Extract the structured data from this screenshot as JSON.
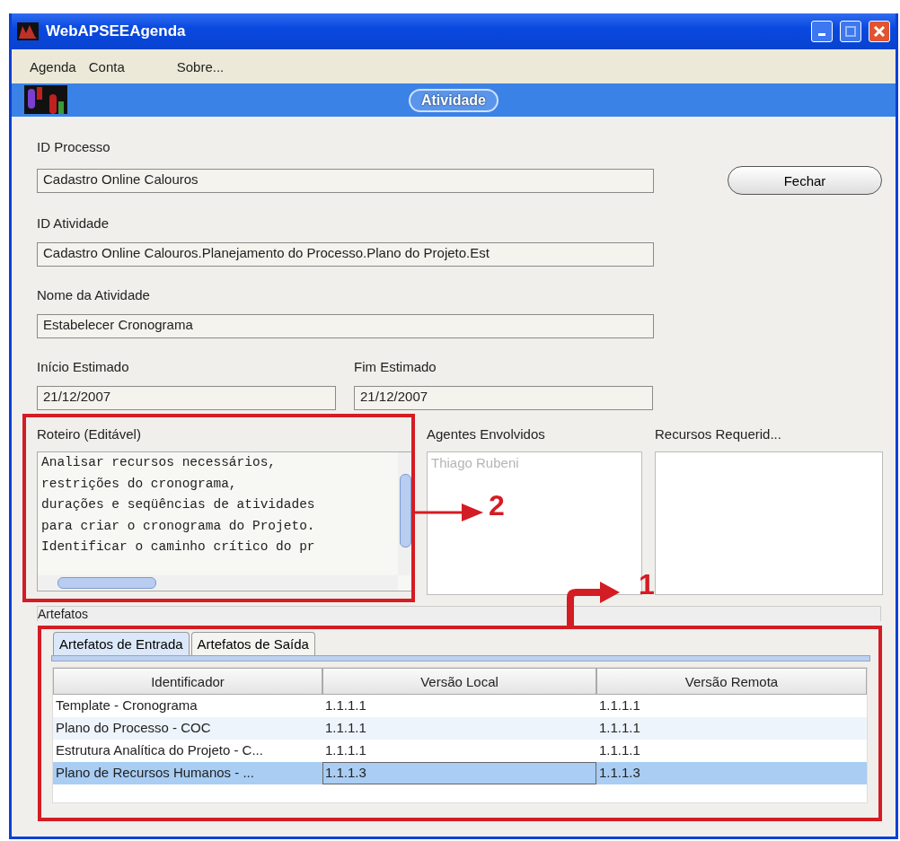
{
  "window": {
    "title": "WebAPSEEAgenda"
  },
  "menu": [
    "Agenda",
    "Conta",
    "Sobre..."
  ],
  "header": {
    "title": "Atividade"
  },
  "fields": {
    "id_processo": {
      "label": "ID Processo",
      "value": "Cadastro  Online  Calouros"
    },
    "id_atividade": {
      "label": "ID Atividade",
      "value": "Cadastro  Online  Calouros.Planejamento do Processo.Plano do Projeto.Est"
    },
    "nome": {
      "label": "Nome da Atividade",
      "value": "Estabelecer Cronograma"
    },
    "inicio": {
      "label": "Início Estimado",
      "value": "21/12/2007"
    },
    "fim": {
      "label": "Fim Estimado",
      "value": "21/12/2007"
    }
  },
  "close_button": "Fechar",
  "roteiro": {
    "label": "Roteiro (Editável)",
    "lines": [
      "Analisar recursos necessários,",
      "restrições do cronograma,",
      "durações e seqüências de atividades",
      "para criar o cronograma do Projeto.",
      "Identificar o caminho crítico do pr"
    ]
  },
  "agentes": {
    "label": "Agentes Envolvidos",
    "items": [
      "Thiago Rubeni"
    ]
  },
  "recursos": {
    "label": "Recursos Requerid..."
  },
  "artefatos": {
    "label": "Artefatos",
    "tabs": [
      {
        "label": "Artefatos de Entrada",
        "selected": true
      },
      {
        "label": "Artefatos de Saída",
        "selected": false
      }
    ],
    "columns": [
      "Identificador",
      "Versão Local",
      "Versão Remota"
    ],
    "rows": [
      {
        "cells": [
          "Template - Cronograma",
          "1.1.1.1",
          "1.1.1.1"
        ],
        "selected": false
      },
      {
        "cells": [
          "Plano do Processo - COC",
          "1.1.1.1",
          "1.1.1.1"
        ],
        "selected": false
      },
      {
        "cells": [
          "Estrutura Analítica do Projeto - C...",
          "1.1.1.1",
          "1.1.1.1"
        ],
        "selected": false
      },
      {
        "cells": [
          "Plano de Recursos Humanos - ...",
          "1.1.1.3",
          "1.1.1.3"
        ],
        "selected": true
      }
    ]
  },
  "annotations": [
    "1",
    "2"
  ]
}
